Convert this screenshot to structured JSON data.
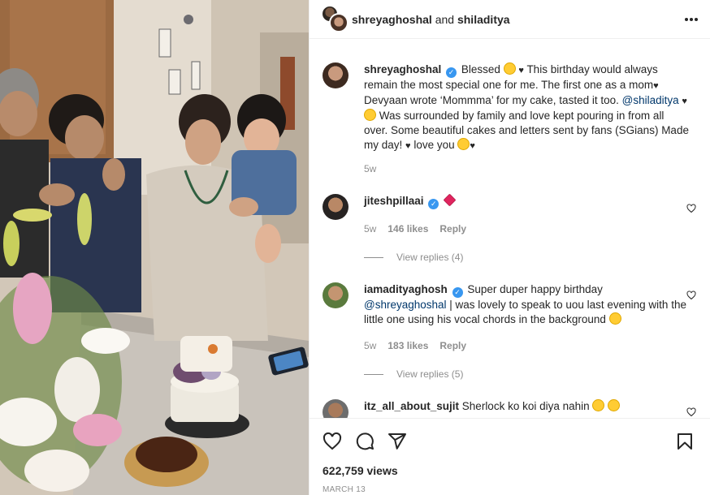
{
  "header": {
    "author": "shreyaghoshal",
    "conjunction": "and",
    "coauthor": "shiladitya"
  },
  "caption": {
    "user": "shreyaghoshal",
    "text_1": "Blessed",
    "text_2": "This birthday would always remain the most special one for me. The first one as a mom",
    "text_3": "Devyaan wrote ‘Mommma’ for my cake, tasted it too.",
    "mention": "@shiladitya",
    "text_4": "Was surrounded by family and love kept pouring in from all over. Some beautiful cakes and letters sent by fans (SGians) Made my day!",
    "text_5": "love you",
    "time": "5w"
  },
  "comments": [
    {
      "user": "jiteshpillaai",
      "time": "5w",
      "likes": "146 likes",
      "reply": "Reply",
      "view_replies": "View replies (4)"
    },
    {
      "user": "iamadityaghosh",
      "text_1": "Super duper happy birthday",
      "mention": "@shreyaghoshal",
      "text_2": "| was lovely to speak to uou last evening with the little one using his vocal chords in the background",
      "time": "5w",
      "likes": "183 likes",
      "reply": "Reply",
      "view_replies": "View replies (5)"
    },
    {
      "user": "itz_all_about_sujit",
      "text": "Sherlock ko koi diya nahin"
    }
  ],
  "stats": {
    "views": "622,759 views",
    "date": "MARCH 13"
  },
  "icons": {
    "like": "heart-icon",
    "comment": "comment-icon",
    "share": "share-icon",
    "save": "bookmark-icon",
    "more": "more-options-icon"
  },
  "colors": {
    "verified": "#3897f0",
    "mention": "#00376b",
    "muted": "#8e8e8e"
  }
}
